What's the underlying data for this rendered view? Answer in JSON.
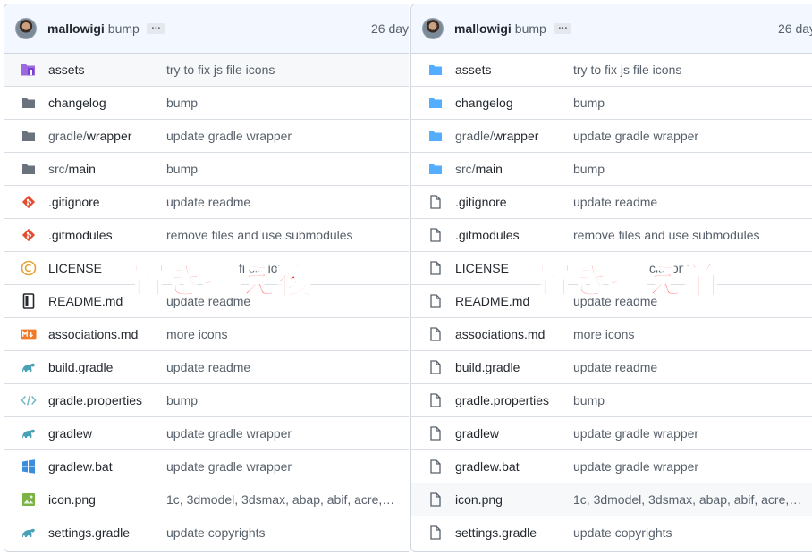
{
  "colors": {
    "border": "#d0d7de",
    "header_bg": "#f3f7ff",
    "folder_blue": "#54aeff",
    "folder_grey": "#6a737d",
    "caption_red": "#ff3a3a"
  },
  "left_panel": {
    "header": {
      "author": "mallowigi",
      "message": "bump",
      "ellipsis": "…",
      "time": "26 day"
    },
    "caption": "置き換え後",
    "rows": [
      {
        "name": "assets",
        "name_dim": "",
        "message": "try to fix js file icons",
        "icon": "assets-folder-purple-icon"
      },
      {
        "name": "changelog",
        "name_dim": "",
        "message": "bump",
        "icon": "folder-grey-icon"
      },
      {
        "name": "wrapper",
        "name_dim": "gradle/",
        "message": "update gradle wrapper",
        "icon": "folder-grey-icon"
      },
      {
        "name": "main",
        "name_dim": "src/",
        "message": "bump",
        "icon": "folder-grey-icon"
      },
      {
        "name": ".gitignore",
        "name_dim": "",
        "message": "update readme",
        "icon": "git-icon"
      },
      {
        "name": ".gitmodules",
        "name_dim": "",
        "message": "remove files and use submodules",
        "icon": "git-icon"
      },
      {
        "name": "LICENSE",
        "name_dim": "",
        "message": "[hidden]",
        "message_tail": "fi   ciations",
        "icon": "copyright-icon"
      },
      {
        "name": "README.md",
        "name_dim": "",
        "message": "update readme",
        "icon": "book-icon"
      },
      {
        "name": "associations.md",
        "name_dim": "",
        "message": "more icons",
        "icon": "markdown-icon"
      },
      {
        "name": "build.gradle",
        "name_dim": "",
        "message": "update readme",
        "icon": "gradle-icon"
      },
      {
        "name": "gradle.properties",
        "name_dim": "",
        "message": "bump",
        "icon": "code-brackets-icon"
      },
      {
        "name": "gradlew",
        "name_dim": "",
        "message": "update gradle wrapper",
        "icon": "gradle-icon"
      },
      {
        "name": "gradlew.bat",
        "name_dim": "",
        "message": "update gradle wrapper",
        "icon": "windows-icon"
      },
      {
        "name": "icon.png",
        "name_dim": "",
        "message": "1c, 3dmodel, 3dsmax, abap, abif, acre,…",
        "icon": "image-icon"
      },
      {
        "name": "settings.gradle",
        "name_dim": "",
        "message": "update copyrights",
        "icon": "gradle-icon"
      }
    ]
  },
  "right_panel": {
    "header": {
      "author": "mallowigi",
      "message": "bump",
      "ellipsis": "…",
      "time": "26 day"
    },
    "caption": "置き換え前",
    "rows": [
      {
        "name": "assets",
        "name_dim": "",
        "message": "try to fix js file icons",
        "icon": "folder-blue-icon"
      },
      {
        "name": "changelog",
        "name_dim": "",
        "message": "bump",
        "icon": "folder-blue-icon"
      },
      {
        "name": "wrapper",
        "name_dim": "gradle/",
        "message": "update gradle wrapper",
        "icon": "folder-blue-icon"
      },
      {
        "name": "main",
        "name_dim": "src/",
        "message": "bump",
        "icon": "folder-blue-icon"
      },
      {
        "name": ".gitignore",
        "name_dim": "",
        "message": "update readme",
        "icon": "file-icon"
      },
      {
        "name": ".gitmodules",
        "name_dim": "",
        "message": "remove files and use submodules",
        "icon": "file-icon"
      },
      {
        "name": "LICENSE",
        "name_dim": "",
        "message": "[hidden]",
        "message_tail": "ciations",
        "icon": "file-icon"
      },
      {
        "name": "README.md",
        "name_dim": "",
        "message": "update readme",
        "icon": "file-icon"
      },
      {
        "name": "associations.md",
        "name_dim": "",
        "message": "more icons",
        "icon": "file-icon"
      },
      {
        "name": "build.gradle",
        "name_dim": "",
        "message": "update readme",
        "icon": "file-icon"
      },
      {
        "name": "gradle.properties",
        "name_dim": "",
        "message": "bump",
        "icon": "file-icon"
      },
      {
        "name": "gradlew",
        "name_dim": "",
        "message": "update gradle wrapper",
        "icon": "file-icon"
      },
      {
        "name": "gradlew.bat",
        "name_dim": "",
        "message": "update gradle wrapper",
        "icon": "file-icon"
      },
      {
        "name": "icon.png",
        "name_dim": "",
        "message": "1c, 3dmodel, 3dsmax, abap, abif, acre,…",
        "icon": "file-icon"
      },
      {
        "name": "settings.gradle",
        "name_dim": "",
        "message": "update copyrights",
        "icon": "file-icon"
      }
    ]
  }
}
